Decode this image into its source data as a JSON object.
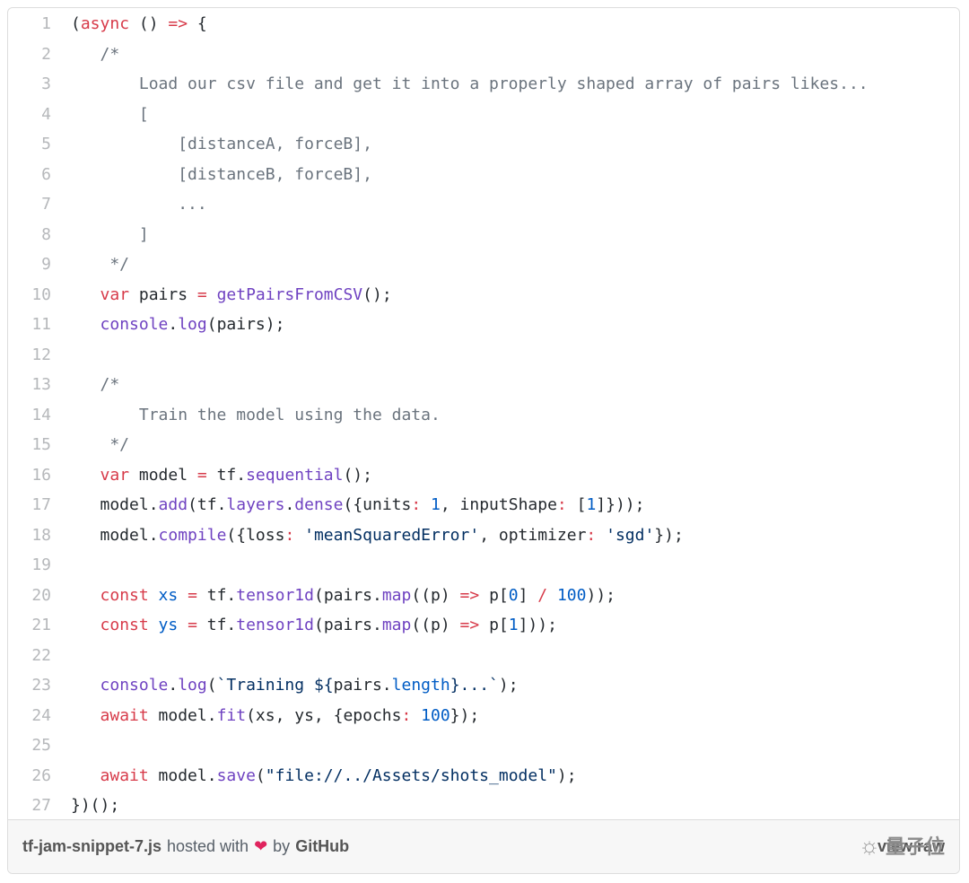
{
  "code_lines": [
    "(async () => {",
    "/*",
    "Load our csv file and get it into a properly shaped array of pairs likes...",
    "[",
    "[distanceA, forceB],",
    "[distanceB, forceB],",
    "...",
    "]",
    "*/",
    "var pairs = getPairsFromCSV();",
    "console.log(pairs);",
    "",
    "/*",
    "Train the model using the data.",
    "*/",
    "var model = tf.sequential();",
    "model.add(tf.layers.dense({units: 1, inputShape: [1]}));",
    "model.compile({loss: 'meanSquaredError', optimizer: 'sgd'});",
    "",
    "const xs = tf.tensor1d(pairs.map((p) => p[0] / 100));",
    "const ys = tf.tensor1d(pairs.map((p) => p[1]));",
    "",
    "console.log(`Training ${pairs.length}...`);",
    "await model.fit(xs, ys, {epochs: 100});",
    "",
    "await model.save(\"file://../Assets/shots_model\");",
    "})();"
  ],
  "footer": {
    "filename": "tf-jam-snippet-7.js",
    "hosted_with": "hosted with",
    "heart": "❤",
    "by": "by",
    "github": "GitHub",
    "view_raw": "view raw"
  },
  "watermark": {
    "icon": "wechat-icon",
    "text": "量子位"
  },
  "colors": {
    "keyword": "#d73a49",
    "function": "#6f42c1",
    "comment": "#6a737d",
    "number": "#005cc5",
    "string": "#032f62",
    "line_number": "#b6b8bb"
  }
}
